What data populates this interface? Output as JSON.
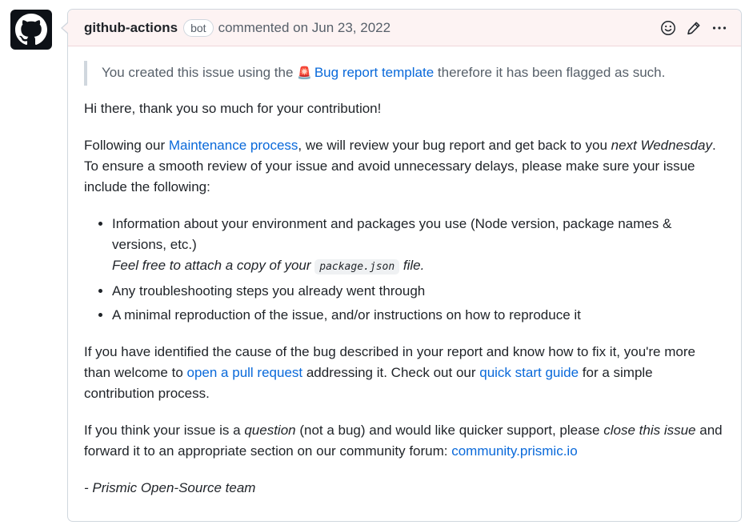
{
  "colors": {
    "link": "#0969da",
    "header_bg": "#fdf3f3",
    "border": "#d0d7de"
  },
  "avatar": {
    "icon": "github-octocat-icon"
  },
  "comment": {
    "author": "github-actions",
    "badge": "bot",
    "meta": "commented on Jun 23, 2022",
    "actions": [
      {
        "icon": "smiley-icon"
      },
      {
        "icon": "pencil-icon"
      },
      {
        "icon": "kebab-horizontal-icon"
      }
    ],
    "quote": {
      "before": "You created this issue using the",
      "emoji": "🚨",
      "link": "Bug report template",
      "after": "therefore it has been flagged as such."
    },
    "greeting": "Hi there, thank you so much for your contribution!",
    "para1": {
      "t1": "Following our ",
      "link": "Maintenance process",
      "t2": ", we will review your bug report and get back to you ",
      "em": "next Wednesday",
      "t3": ". To ensure a smooth review of your issue and avoid unnecessary delays, please make sure your issue include the following:"
    },
    "list": {
      "item1_text": "Information about your environment and packages you use (Node version, package names & versions, etc.)",
      "item1_em_before": "Feel free to attach a copy of your ",
      "item1_code": "package.json",
      "item1_em_after": " file.",
      "item2": "Any troubleshooting steps you already went through",
      "item3": "A minimal reproduction of the issue, and/or instructions on how to reproduce it"
    },
    "para2": {
      "t1": "If you have identified the cause of the bug described in your report and know how to fix it, you're more than welcome to ",
      "link1": "open a pull request",
      "t2": " addressing it. Check out our ",
      "link2": "quick start guide",
      "t3": " for a simple contribution process."
    },
    "para3": {
      "t1": "If you think your issue is a ",
      "em1": "question",
      "t2": " (not a bug) and would like quicker support, please ",
      "em2": "close this issue",
      "t3": " and forward it to an appropriate section on our community forum: ",
      "link": "community.prismic.io"
    },
    "signature": "- Prismic Open-Source team"
  }
}
